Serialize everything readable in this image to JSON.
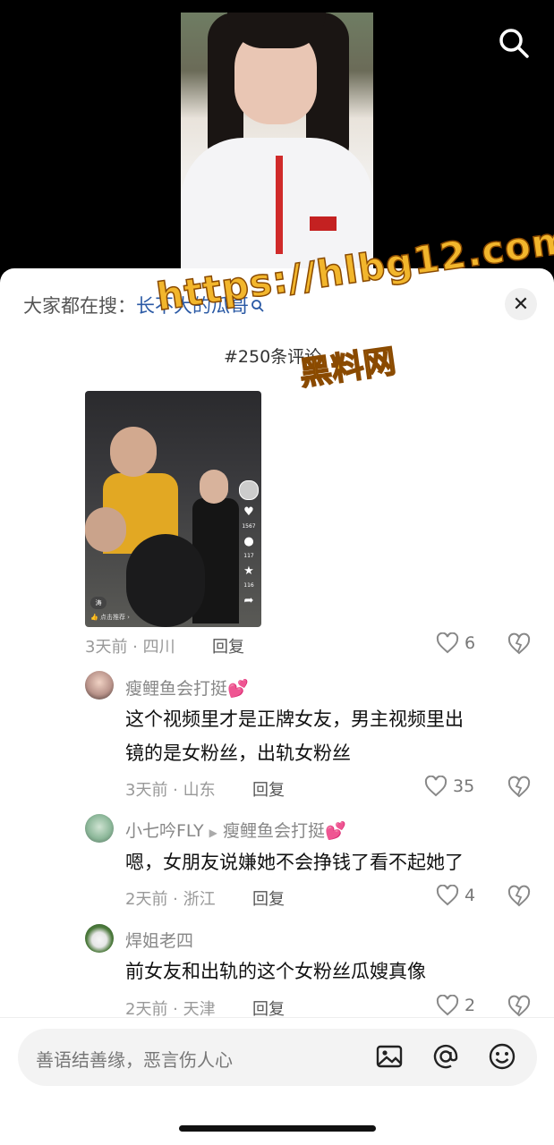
{
  "hot_search": {
    "prefix": "大家都在搜：",
    "keyword": "长不大的瓜哥"
  },
  "comment_count": "#250条评论",
  "watermark": {
    "url": "https://hlbg12.com",
    "name": "黑料网"
  },
  "thumbnail": {
    "likes": "1567",
    "comments": "117",
    "stars": "116",
    "tag": "涛",
    "recommend": "点击推荐"
  },
  "root_comment": {
    "meta": "3天前 · 四川",
    "reply": "回复",
    "likes": "6"
  },
  "replies": [
    {
      "user": "瘦鲤鱼会打挺",
      "emoji": "💕",
      "text_line1": "这个视频里才是正牌女友，男主视频里出",
      "text_line2": "镜的是女粉丝，出轨女粉丝",
      "meta": "3天前 · 山东",
      "reply": "回复",
      "likes": "35"
    },
    {
      "user": "小七吟FLY",
      "arrow": "▶",
      "reply_to": "瘦鲤鱼会打挺",
      "emoji": "💕",
      "text_line1": "嗯，女朋友说嫌她不会挣钱了看不起她了",
      "meta": "2天前 · 浙江",
      "reply": "回复",
      "likes": "4"
    },
    {
      "user": "焊姐老四",
      "text_line1": "前女友和出轨的这个女粉丝瓜嫂真像",
      "meta": "2天前 · 天津",
      "reply": "回复",
      "likes": "2"
    }
  ],
  "input": {
    "placeholder": "善语结善缘，恶言伤人心"
  },
  "colors": {
    "link": "#2b5aa5",
    "watermark": "#f2b62c"
  }
}
